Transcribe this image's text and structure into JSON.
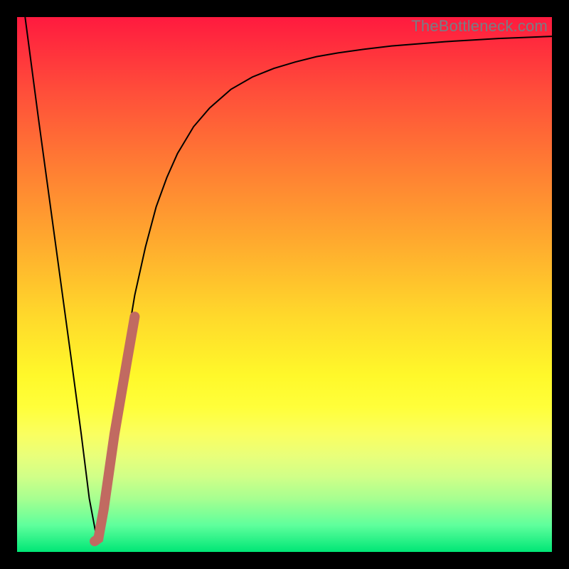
{
  "watermark": "TheBottleneck.com",
  "chart_data": {
    "type": "line",
    "title": "",
    "xlabel": "",
    "ylabel": "",
    "xlim": [
      0,
      100
    ],
    "ylim": [
      0,
      100
    ],
    "annotations": [],
    "series": [
      {
        "name": "main-curve",
        "color": "#000000",
        "stroke_width": 2,
        "x": [
          1.5,
          4,
          7,
          10,
          12,
          13.5,
          15,
          16.5,
          18,
          20,
          22,
          24,
          26,
          28,
          30,
          33,
          36,
          40,
          44,
          48,
          52,
          56,
          60,
          65,
          70,
          75,
          80,
          85,
          90,
          95,
          100
        ],
        "values": [
          100,
          81,
          59,
          37,
          22,
          10,
          2,
          12,
          23,
          36,
          48,
          57,
          64.5,
          70,
          74.5,
          79.5,
          83,
          86.5,
          88.8,
          90.4,
          91.6,
          92.6,
          93.3,
          94,
          94.6,
          95,
          95.4,
          95.7,
          96,
          96.2,
          96.4
        ]
      },
      {
        "name": "highlight-segment",
        "color": "#c16a61",
        "stroke_width": 14,
        "linecap": "round",
        "x": [
          14.5,
          15.2,
          16.2,
          17.2,
          18.2,
          19.4,
          20.6,
          22
        ],
        "values": [
          2,
          2.5,
          8,
          15,
          22,
          29,
          36,
          44
        ]
      }
    ]
  }
}
